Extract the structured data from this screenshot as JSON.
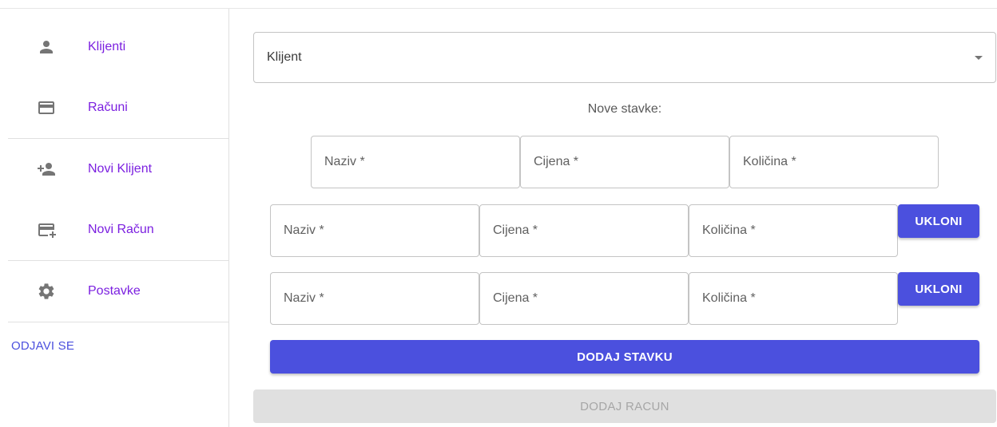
{
  "sidebar": {
    "items": [
      {
        "label": "Klijenti",
        "icon": "person-icon"
      },
      {
        "label": "Računi",
        "icon": "credit-card-icon"
      },
      {
        "label": "Novi Klijent",
        "icon": "person-add-icon"
      },
      {
        "label": "Novi Račun",
        "icon": "add-card-icon"
      },
      {
        "label": "Postavke",
        "icon": "gear-icon"
      }
    ],
    "logout_label": "ODJAVI SE"
  },
  "main": {
    "client_select": {
      "placeholder": "Klijent",
      "icon": "dropdown-arrow-icon"
    },
    "section_title": "Nove stavke:",
    "item_rows": [
      {
        "name_placeholder": "Naziv *",
        "price_placeholder": "Cijena *",
        "quantity_placeholder": "Količina *"
      },
      {
        "name_placeholder": "Naziv *",
        "price_placeholder": "Cijena *",
        "quantity_placeholder": "Količina *",
        "remove_label": "UKLONI"
      },
      {
        "name_placeholder": "Naziv *",
        "price_placeholder": "Cijena *",
        "quantity_placeholder": "Količina *",
        "remove_label": "UKLONI"
      }
    ],
    "add_item_label": "DODAJ STAVKU",
    "add_invoice_label": "DODAJ RACUN"
  },
  "colors": {
    "accent": "#4b50de",
    "nav_text": "#7b1fe0",
    "disabled_bg": "#e0e0e0",
    "disabled_text": "#a6a6a6",
    "border": "#c4c4c4"
  }
}
